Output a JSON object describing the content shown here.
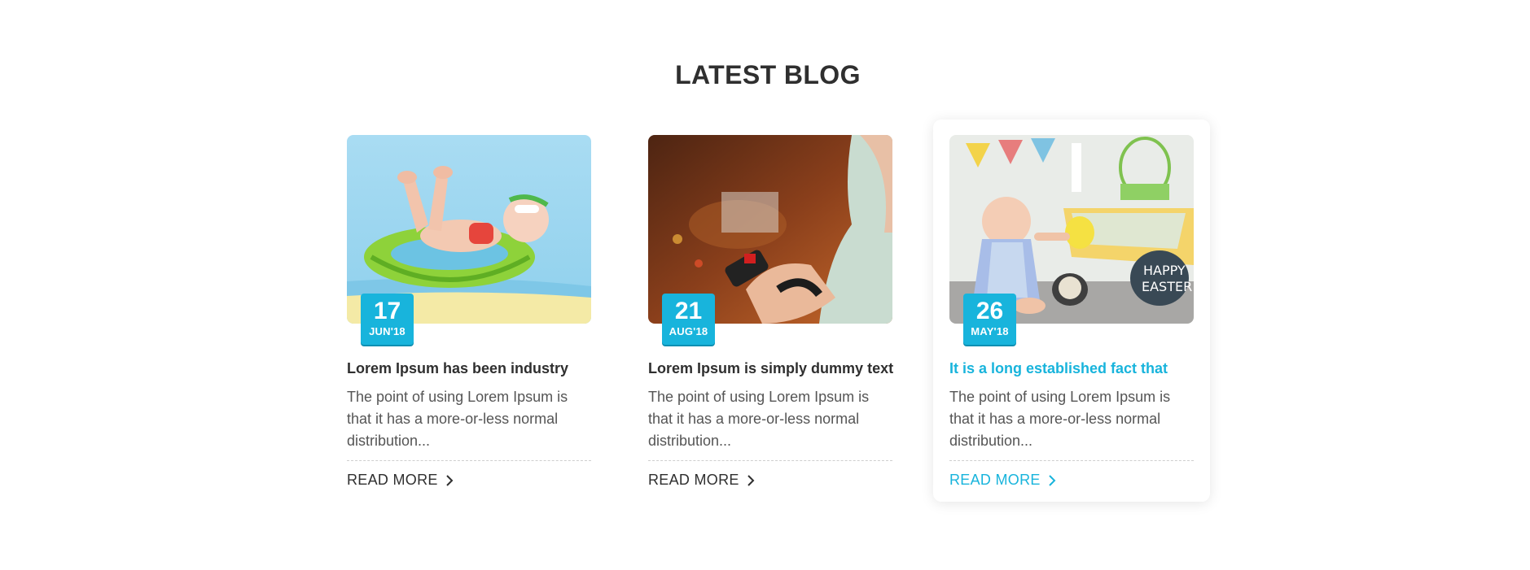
{
  "section": {
    "title": "LATEST BLOG"
  },
  "posts": [
    {
      "day": "17",
      "month": "JUN'18",
      "title": "Lorem Ipsum has been industry",
      "excerpt": "The point of using Lorem Ipsum is that it has a more-or-less normal distribution...",
      "read_more": "READ MORE",
      "image": "baby-in-swim-ring-photo"
    },
    {
      "day": "21",
      "month": "AUG'18",
      "title": "Lorem Ipsum is simply dummy text",
      "excerpt": "The point of using Lorem Ipsum is that it has a more-or-less normal distribution...",
      "read_more": "READ MORE",
      "image": "child-playing-toy-photo"
    },
    {
      "day": "26",
      "month": "MAY'18",
      "title": "It is a long established fact that",
      "excerpt": "The point of using Lorem Ipsum is that it has a more-or-less normal distribution...",
      "read_more": "READ MORE",
      "image": "baby-easter-scene-photo"
    }
  ],
  "colors": {
    "accent": "#18b4dc",
    "heading": "#2f2f2f",
    "body_text": "#555555"
  },
  "icons": {
    "read_more": "chevron-right-icon"
  }
}
